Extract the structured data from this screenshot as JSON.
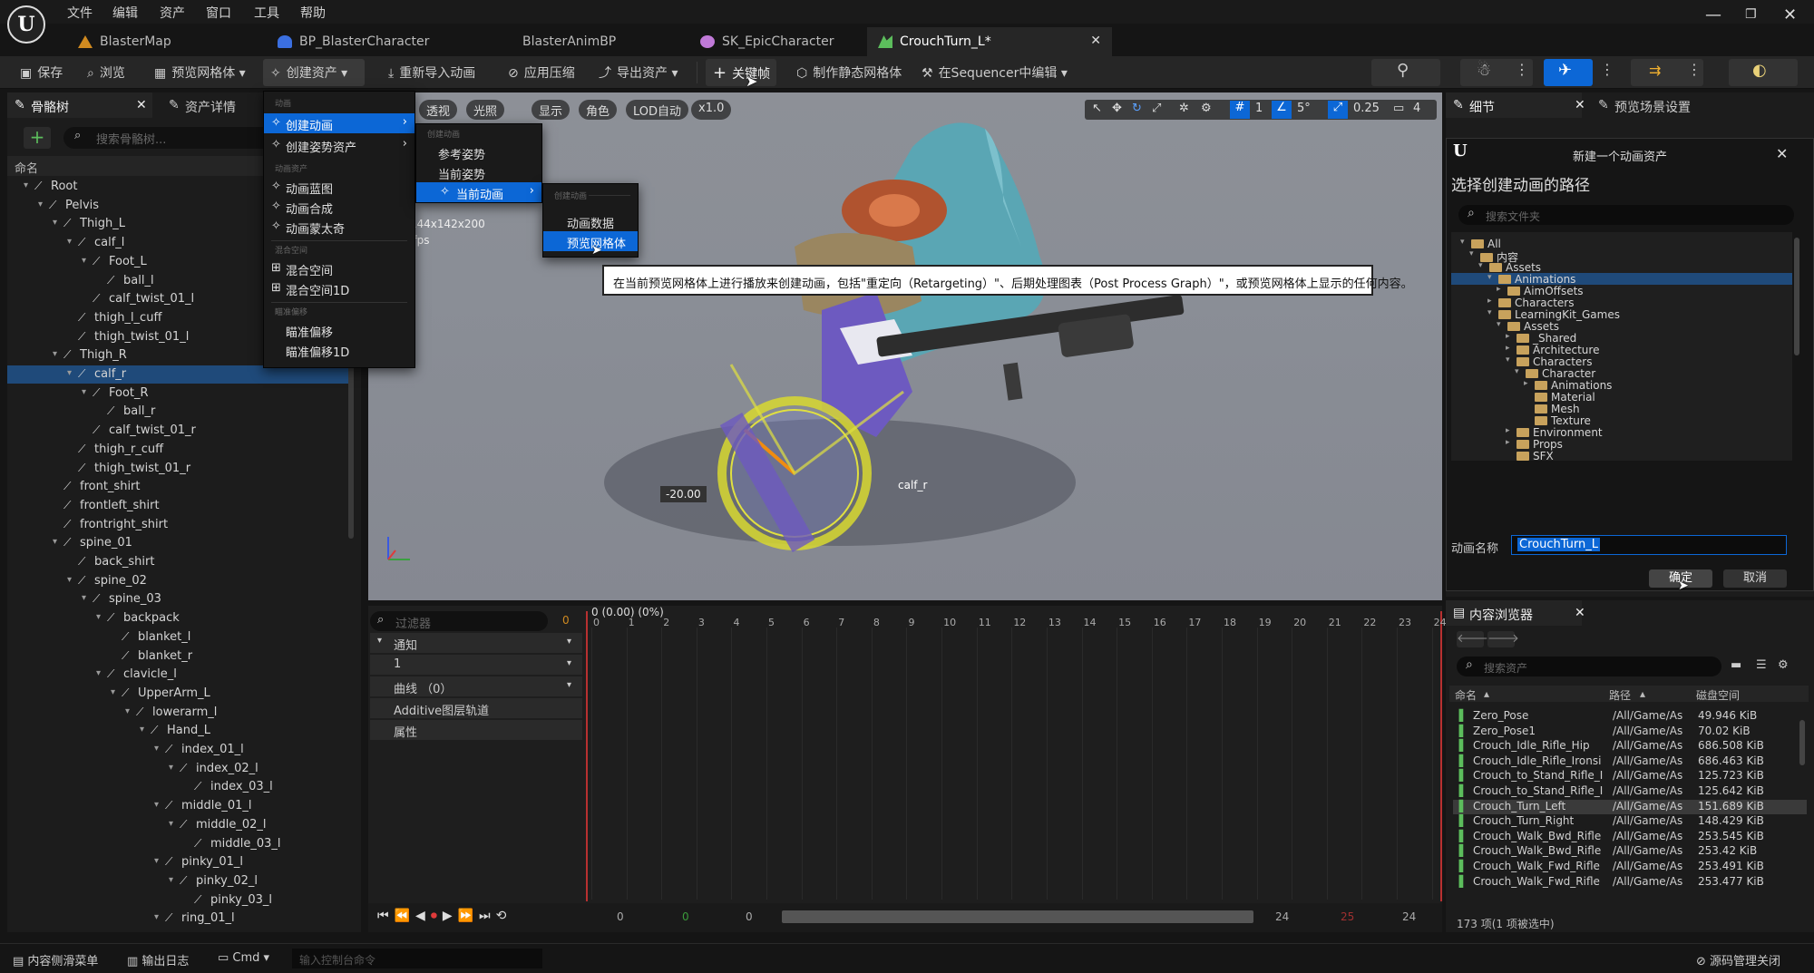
{
  "menubar": {
    "items": [
      "文件",
      "编辑",
      "资产",
      "窗口",
      "工具",
      "帮助"
    ]
  },
  "tabs": [
    {
      "label": "BlasterMap",
      "color": "#d08a20"
    },
    {
      "label": "BP_BlasterCharacter",
      "color": "#3b6fe0"
    },
    {
      "label": "BlasterAnimBP",
      "color": "#3b6fe0"
    },
    {
      "label": "SK_EpicCharacter",
      "color": "#c07ad8"
    },
    {
      "label": "CrouchTurn_L*",
      "color": "#5cbd5c"
    }
  ],
  "toolbar": {
    "save": "保存",
    "browse": "浏览",
    "preview_mesh": "预览网格体",
    "create_asset": "创建资产",
    "reimport": "重新导入动画",
    "apply_compress": "应用压缩",
    "export_asset": "导出资产",
    "key": "关键帧",
    "make_static": "制作静态网格体",
    "edit_in_sequencer": "在Sequencer中编辑"
  },
  "left_panel": {
    "tab_skeleton": "骨骼树",
    "tab_asset_details": "资产详情",
    "search_placeholder": "搜索骨骼树...",
    "col_name": "命名",
    "bones": [
      {
        "name": "Root",
        "depth": 0,
        "open": true
      },
      {
        "name": "Pelvis",
        "depth": 1,
        "open": true
      },
      {
        "name": "Thigh_L",
        "depth": 2,
        "open": true
      },
      {
        "name": "calf_l",
        "depth": 3,
        "open": true
      },
      {
        "name": "Foot_L",
        "depth": 4,
        "open": true
      },
      {
        "name": "ball_l",
        "depth": 5
      },
      {
        "name": "calf_twist_01_l",
        "depth": 4
      },
      {
        "name": "thigh_l_cuff",
        "depth": 3
      },
      {
        "name": "thigh_twist_01_l",
        "depth": 3
      },
      {
        "name": "Thigh_R",
        "depth": 2,
        "open": true
      },
      {
        "name": "calf_r",
        "depth": 3,
        "open": true,
        "selected": true
      },
      {
        "name": "Foot_R",
        "depth": 4,
        "open": true
      },
      {
        "name": "ball_r",
        "depth": 5
      },
      {
        "name": "calf_twist_01_r",
        "depth": 4
      },
      {
        "name": "thigh_r_cuff",
        "depth": 3
      },
      {
        "name": "thigh_twist_01_r",
        "depth": 3
      },
      {
        "name": "front_shirt",
        "depth": 2
      },
      {
        "name": "frontleft_shirt",
        "depth": 2
      },
      {
        "name": "frontright_shirt",
        "depth": 2
      },
      {
        "name": "spine_01",
        "depth": 2,
        "open": true
      },
      {
        "name": "back_shirt",
        "depth": 3
      },
      {
        "name": "spine_02",
        "depth": 3,
        "open": true
      },
      {
        "name": "spine_03",
        "depth": 4,
        "open": true
      },
      {
        "name": "backpack",
        "depth": 5,
        "open": true
      },
      {
        "name": "blanket_l",
        "depth": 6
      },
      {
        "name": "blanket_r",
        "depth": 6
      },
      {
        "name": "clavicle_l",
        "depth": 5,
        "open": true
      },
      {
        "name": "UpperArm_L",
        "depth": 6,
        "open": true
      },
      {
        "name": "lowerarm_l",
        "depth": 7,
        "open": true
      },
      {
        "name": "Hand_L",
        "depth": 8,
        "open": true
      },
      {
        "name": "index_01_l",
        "depth": 9,
        "open": true
      },
      {
        "name": "index_02_l",
        "depth": 10,
        "open": true
      },
      {
        "name": "index_03_l",
        "depth": 11
      },
      {
        "name": "middle_01_l",
        "depth": 9,
        "open": true
      },
      {
        "name": "middle_02_l",
        "depth": 10,
        "open": true
      },
      {
        "name": "middle_03_l",
        "depth": 11
      },
      {
        "name": "pinky_01_l",
        "depth": 9,
        "open": true
      },
      {
        "name": "pinky_02_l",
        "depth": 10,
        "open": true
      },
      {
        "name": "pinky_03_l",
        "depth": 11
      },
      {
        "name": "ring_01_l",
        "depth": 9,
        "open": true
      }
    ]
  },
  "viewport": {
    "btns": [
      "透视",
      "光照",
      "显示",
      "角色",
      "LOD自动",
      "x1.0"
    ],
    "stats1": ": 144x142x200",
    "stats2": "0 fps",
    "angle": "5°",
    "scale": "0.25",
    "cam": "4",
    "grid": "1",
    "value_label": "-20.00",
    "bone_label": "calf_r"
  },
  "menus": {
    "main_section": "动画",
    "create_anim": "创建动画",
    "create_pose": "创建姿势资产",
    "anim_assets_section": "动画资产",
    "blueprint": "动画蓝图",
    "composite": "动画合成",
    "montage": "动画蒙太奇",
    "blend_section": "混合空间",
    "blendspace": "混合空间",
    "blendspace1d": "混合空间1D",
    "aim_section": "瞄准偏移",
    "aimoffset": "瞄准偏移",
    "aimoffset1d": "瞄准偏移1D",
    "sub_section": "创建动画",
    "ref_pose": "参考姿势",
    "cur_pose": "当前姿势",
    "cur_anim": "当前动画",
    "sub2_section": "创建动画",
    "anim_data": "动画数据",
    "preview_mesh": "预览网格体",
    "tooltip": "在当前预览网格体上进行播放来创建动画，包括\"重定向（Retargeting）\"、后期处理图表（Post Process Graph）\"，或预览网格体上显示的任何内容。"
  },
  "timeline": {
    "filter_placeholder": "过滤器",
    "filter_count": "0",
    "header": "0 (0.00) (0%)",
    "rows": [
      "通知",
      "1",
      "曲线 （0）",
      "Additive图层轨道",
      "属性"
    ],
    "ticks": [
      "0",
      "1",
      "2",
      "3",
      "4",
      "5",
      "6",
      "7",
      "8",
      "9",
      "10",
      "11",
      "12",
      "13",
      "14",
      "15",
      "16",
      "17",
      "18",
      "19",
      "20",
      "21",
      "22",
      "23",
      "24"
    ],
    "frame_a": "0",
    "frame_b": "0",
    "frame_c": "0",
    "end_a": "24",
    "end_b": "25",
    "end_c": "24"
  },
  "right_panel": {
    "tab_details": "细节",
    "tab_preview_scene": "预览场景设置",
    "dialog_title": "新建一个动画资产",
    "dialog_heading": "选择创建动画的路径",
    "search_folders": "搜索文件夹",
    "folders": [
      {
        "name": "All",
        "depth": 0,
        "open": true
      },
      {
        "name": "内容",
        "depth": 1,
        "open": true
      },
      {
        "name": "Assets",
        "depth": 2,
        "open": true
      },
      {
        "name": "Animations",
        "depth": 3,
        "open": true,
        "selected": true
      },
      {
        "name": "AimOffsets",
        "depth": 4,
        "closed": true
      },
      {
        "name": "Characters",
        "depth": 3,
        "closed": true
      },
      {
        "name": "LearningKit_Games",
        "depth": 3,
        "open": true
      },
      {
        "name": "Assets",
        "depth": 4,
        "open": true
      },
      {
        "name": "_Shared",
        "depth": 5,
        "closed": true
      },
      {
        "name": "Architecture",
        "depth": 5,
        "closed": true
      },
      {
        "name": "Characters",
        "depth": 5,
        "open": true
      },
      {
        "name": "Character",
        "depth": 6,
        "open": true
      },
      {
        "name": "Animations",
        "depth": 7,
        "closed": true
      },
      {
        "name": "Material",
        "depth": 7
      },
      {
        "name": "Mesh",
        "depth": 7
      },
      {
        "name": "Texture",
        "depth": 7
      },
      {
        "name": "Environment",
        "depth": 5,
        "closed": true
      },
      {
        "name": "Props",
        "depth": 5,
        "closed": true
      },
      {
        "name": "SFX",
        "depth": 5
      }
    ],
    "name_label": "动画名称",
    "name_value": "CrouchTurn_L",
    "ok": "确定",
    "cancel": "取消"
  },
  "content_browser": {
    "tab": "内容浏览器",
    "search_placeholder": "搜索资产",
    "col_name": "命名",
    "col_path": "路径",
    "col_disk": "磁盘空间",
    "assets": [
      {
        "name": "Zero_Pose",
        "path": "/All/Game/As",
        "size": "49.946 KiB"
      },
      {
        "name": "Zero_Pose1",
        "path": "/All/Game/As",
        "size": "70.02 KiB"
      },
      {
        "name": "Crouch_Idle_Rifle_Hip",
        "path": "/All/Game/As",
        "size": "686.508 KiB"
      },
      {
        "name": "Crouch_Idle_Rifle_Ironsi",
        "path": "/All/Game/As",
        "size": "686.463 KiB"
      },
      {
        "name": "Crouch_to_Stand_Rifle_I",
        "path": "/All/Game/As",
        "size": "125.723 KiB"
      },
      {
        "name": "Crouch_to_Stand_Rifle_I",
        "path": "/All/Game/As",
        "size": "125.642 KiB"
      },
      {
        "name": "Crouch_Turn_Left",
        "path": "/All/Game/As",
        "size": "151.689 KiB",
        "selected": true
      },
      {
        "name": "Crouch_Turn_Right",
        "path": "/All/Game/As",
        "size": "148.429 KiB"
      },
      {
        "name": "Crouch_Walk_Bwd_Rifle",
        "path": "/All/Game/As",
        "size": "253.545 KiB"
      },
      {
        "name": "Crouch_Walk_Bwd_Rifle",
        "path": "/All/Game/As",
        "size": "253.42 KiB"
      },
      {
        "name": "Crouch_Walk_Fwd_Rifle",
        "path": "/All/Game/As",
        "size": "253.491 KiB"
      },
      {
        "name": "Crouch_Walk_Fwd_Rifle",
        "path": "/All/Game/As",
        "size": "253.477 KiB"
      }
    ],
    "count": "173 项(1 项被选中)"
  },
  "statusbar": {
    "drawer": "内容侧滑菜单",
    "output_log": "输出日志",
    "cmd": "Cmd",
    "console_placeholder": "输入控制台命令",
    "source_control": "源码管理关闭"
  }
}
